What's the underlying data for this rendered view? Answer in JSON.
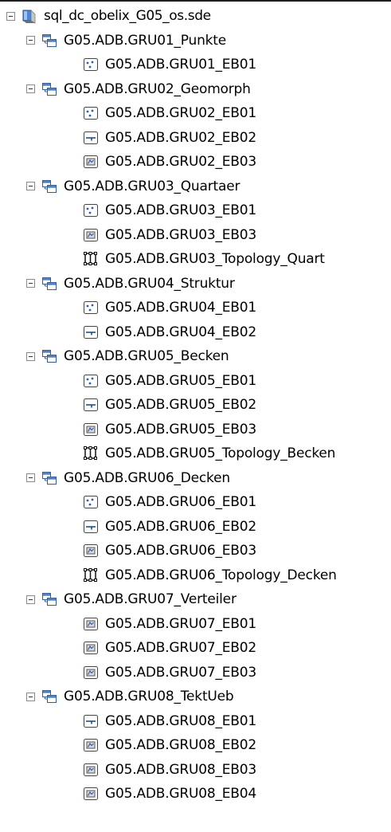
{
  "database": {
    "label": "sql_dc_obelix_G05_os.sde",
    "icon": "database-icon"
  },
  "datasets": [
    {
      "label": "G05.ADB.GRU01_Punkte",
      "icon": "feature-dataset-icon",
      "children": [
        {
          "label": "G05.ADB.GRU01_EB01",
          "icon": "point-feature-class-icon"
        }
      ]
    },
    {
      "label": "G05.ADB.GRU02_Geomorph",
      "icon": "feature-dataset-icon",
      "children": [
        {
          "label": "G05.ADB.GRU02_EB01",
          "icon": "point-feature-class-icon"
        },
        {
          "label": "G05.ADB.GRU02_EB02",
          "icon": "line-feature-class-icon"
        },
        {
          "label": "G05.ADB.GRU02_EB03",
          "icon": "polygon-feature-class-icon"
        }
      ]
    },
    {
      "label": "G05.ADB.GRU03_Quartaer",
      "icon": "feature-dataset-icon",
      "children": [
        {
          "label": "G05.ADB.GRU03_EB01",
          "icon": "point-feature-class-icon"
        },
        {
          "label": "G05.ADB.GRU03_EB03",
          "icon": "polygon-feature-class-icon"
        },
        {
          "label": "G05.ADB.GRU03_Topology_Quart",
          "icon": "topology-icon"
        }
      ]
    },
    {
      "label": "G05.ADB.GRU04_Struktur",
      "icon": "feature-dataset-icon",
      "children": [
        {
          "label": "G05.ADB.GRU04_EB01",
          "icon": "point-feature-class-icon"
        },
        {
          "label": "G05.ADB.GRU04_EB02",
          "icon": "line-feature-class-icon"
        }
      ]
    },
    {
      "label": "G05.ADB.GRU05_Becken",
      "icon": "feature-dataset-icon",
      "children": [
        {
          "label": "G05.ADB.GRU05_EB01",
          "icon": "point-feature-class-icon"
        },
        {
          "label": "G05.ADB.GRU05_EB02",
          "icon": "line-feature-class-icon"
        },
        {
          "label": "G05.ADB.GRU05_EB03",
          "icon": "polygon-feature-class-icon"
        },
        {
          "label": "G05.ADB.GRU05_Topology_Becken",
          "icon": "topology-icon"
        }
      ]
    },
    {
      "label": "G05.ADB.GRU06_Decken",
      "icon": "feature-dataset-icon",
      "children": [
        {
          "label": "G05.ADB.GRU06_EB01",
          "icon": "point-feature-class-icon"
        },
        {
          "label": "G05.ADB.GRU06_EB02",
          "icon": "line-feature-class-icon"
        },
        {
          "label": "G05.ADB.GRU06_EB03",
          "icon": "polygon-feature-class-icon"
        },
        {
          "label": "G05.ADB.GRU06_Topology_Decken",
          "icon": "topology-icon"
        }
      ]
    },
    {
      "label": "G05.ADB.GRU07_Verteiler",
      "icon": "feature-dataset-icon",
      "children": [
        {
          "label": "G05.ADB.GRU07_EB01",
          "icon": "polygon-feature-class-icon"
        },
        {
          "label": "G05.ADB.GRU07_EB02",
          "icon": "polygon-feature-class-icon"
        },
        {
          "label": "G05.ADB.GRU07_EB03",
          "icon": "polygon-feature-class-icon"
        }
      ]
    },
    {
      "label": "G05.ADB.GRU08_TektUeb",
      "icon": "feature-dataset-icon",
      "children": [
        {
          "label": "G05.ADB.GRU08_EB01",
          "icon": "line-feature-class-icon"
        },
        {
          "label": "G05.ADB.GRU08_EB02",
          "icon": "polygon-feature-class-icon"
        },
        {
          "label": "G05.ADB.GRU08_EB03",
          "icon": "polygon-feature-class-icon"
        },
        {
          "label": "G05.ADB.GRU08_EB04",
          "icon": "polygon-feature-class-icon"
        }
      ]
    }
  ]
}
